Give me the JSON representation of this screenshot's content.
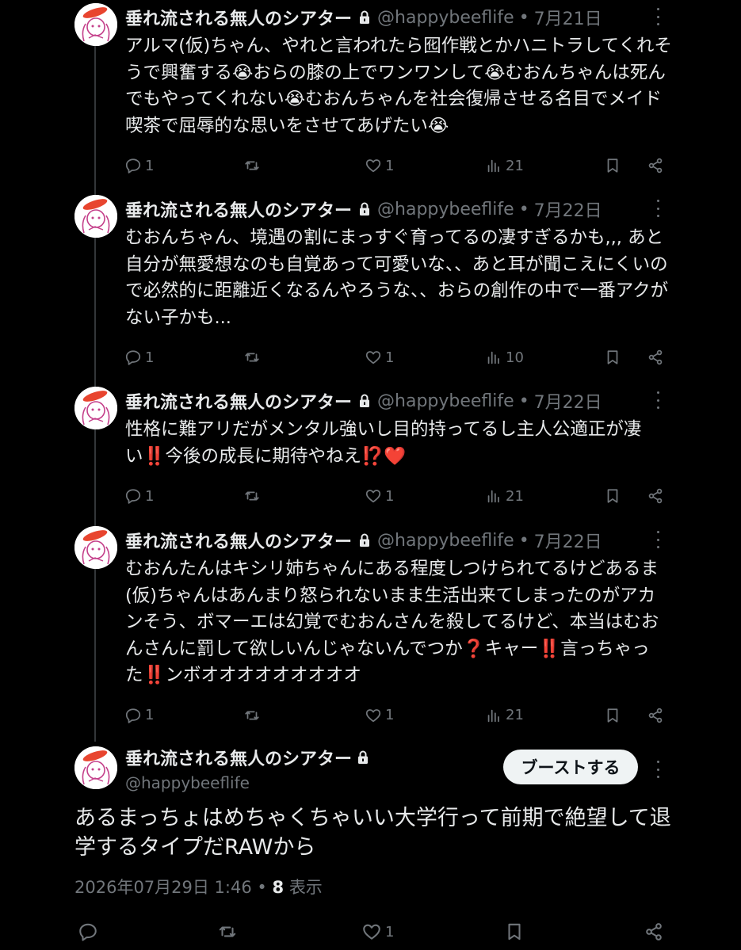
{
  "author": {
    "display_name": "垂れ流される無人のシアター",
    "handle": "@happybeeflife"
  },
  "replies": [
    {
      "date": "7月21日",
      "text": "アルマ(仮)ちゃん、やれと言われたら囮作戦とかハニトラしてくれそうで興奮する😭おらの膝の上でワンワンして😭むおんちゃんは死んでもやってくれない😭むおんちゃんを社会復帰させる名目でメイド喫茶で屈辱的な思いをさせてあげたい😭",
      "reply_count": "1",
      "like_count": "1",
      "view_count": "21"
    },
    {
      "date": "7月22日",
      "text": "むおんちゃん、境遇の割にまっすぐ育ってるの凄すぎるかも,,, あと自分が無愛想なのも自覚あって可愛いな、、あと耳が聞こえにくいので必然的に距離近くなるんやろうな、、おらの創作の中で一番アクがない子かも...",
      "reply_count": "1",
      "like_count": "1",
      "view_count": "10"
    },
    {
      "date": "7月22日",
      "text": "性格に難アリだがメンタル強いし目的持ってるし主人公適正が凄い‼️今後の成長に期待やねえ⁉️❤️",
      "reply_count": "1",
      "like_count": "1",
      "view_count": "21"
    },
    {
      "date": "7月22日",
      "text": "むおんたんはキシリ姉ちゃんにある程度しつけられてるけどあるま(仮)ちゃんはあんまり怒られないまま生活出来てしまったのがアカンそう、ボマーエは幻覚でむおんさんを殺してるけど、本当はむおんさんに罰して欲しいんじゃないんでつか❓キャー‼️言っちゃった‼️ンボオオオオオオオオオ",
      "reply_count": "1",
      "like_count": "1",
      "view_count": "21"
    }
  ],
  "main_post": {
    "boost_label": "ブーストする",
    "text": "あるまっちょはめちゃくちゃいい大学行って前期で絶望して退学するタイプだRAWから",
    "timestamp": "2026年07月29日 1:46",
    "separator": "•",
    "views_number": "8",
    "views_label": "表示",
    "like_count": "1"
  },
  "colors": {
    "background": "#000000",
    "text": "#e7e9ea",
    "muted": "#71767b",
    "button_bg": "#eff3f4"
  },
  "icons": [
    "reply-icon",
    "boost-icon",
    "like-icon",
    "views-icon",
    "bookmark-icon",
    "share-icon",
    "lock-icon",
    "more-icon"
  ]
}
